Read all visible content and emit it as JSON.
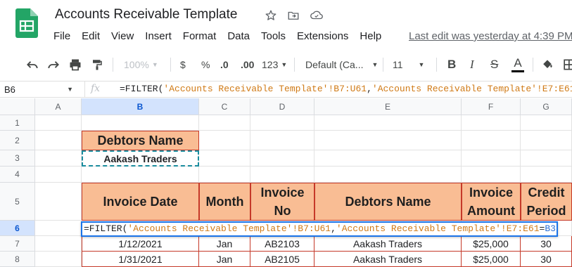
{
  "app": {
    "doc_title": "Accounts Receivable Template",
    "menu": [
      "File",
      "Edit",
      "View",
      "Insert",
      "Format",
      "Data",
      "Tools",
      "Extensions",
      "Help"
    ],
    "last_edit": "Last edit was yesterday at 4:39 PM"
  },
  "toolbar": {
    "zoom": "100%",
    "currency": "$",
    "percent": "%",
    "decrease_decimal": ".0",
    "increase_decimal": ".00",
    "more_formats": "123",
    "font": "Default (Ca...",
    "font_size": "11",
    "bold": "B",
    "italic": "I",
    "strike": "S",
    "text_color": "A"
  },
  "formula_bar": {
    "cell_ref": "B6",
    "fx": "fx",
    "formula_parts": [
      {
        "text": "=FILTER(",
        "color": "black"
      },
      {
        "text": "'Accounts Receivable Template'!B7:U61",
        "color": "orange"
      },
      {
        "text": ",",
        "color": "black"
      },
      {
        "text": "'Accounts Receivable Template'!E7:E61",
        "color": "orange"
      },
      {
        "text": "=",
        "color": "black"
      }
    ]
  },
  "editor": {
    "formula_parts": [
      {
        "text": "=FILTER(",
        "color": "black"
      },
      {
        "text": "'Accounts Receivable Template'!B7:U61",
        "color": "orange"
      },
      {
        "text": ",",
        "color": "black"
      },
      {
        "text": "'Accounts Receivable Template'!E7:E61",
        "color": "orange"
      },
      {
        "text": "=",
        "color": "black"
      },
      {
        "text": "B3",
        "color": "blue"
      },
      {
        "text": ")",
        "color": "black"
      }
    ]
  },
  "grid": {
    "columns": [
      "A",
      "B",
      "C",
      "D",
      "E",
      "F",
      "G"
    ],
    "rows": [
      "1",
      "2",
      "3",
      "4",
      "5",
      "6",
      "7",
      "8"
    ],
    "selected_column": "B",
    "selected_row": "6",
    "debtor_label": "Debtors Name",
    "debtor_value": "Aakash Traders",
    "headers": [
      "Invoice Date",
      "Month",
      "Invoice No",
      "Debtors Name",
      "Invoice Amount",
      "Credit Period"
    ],
    "data_rows": [
      [
        "1/12/2021",
        "Jan",
        "AB2103",
        "Aakash Traders",
        "$25,000",
        "30"
      ],
      [
        "1/31/2021",
        "Jan",
        "AB2105",
        "Aakash Traders",
        "$25,000",
        "30"
      ]
    ]
  },
  "colors": {
    "header_fill": "#f9bd94",
    "header_border": "#c53929",
    "selection_blue": "#1a73e8",
    "formula_range": "#d07a16",
    "formula_ref": "#2a6fd6"
  }
}
